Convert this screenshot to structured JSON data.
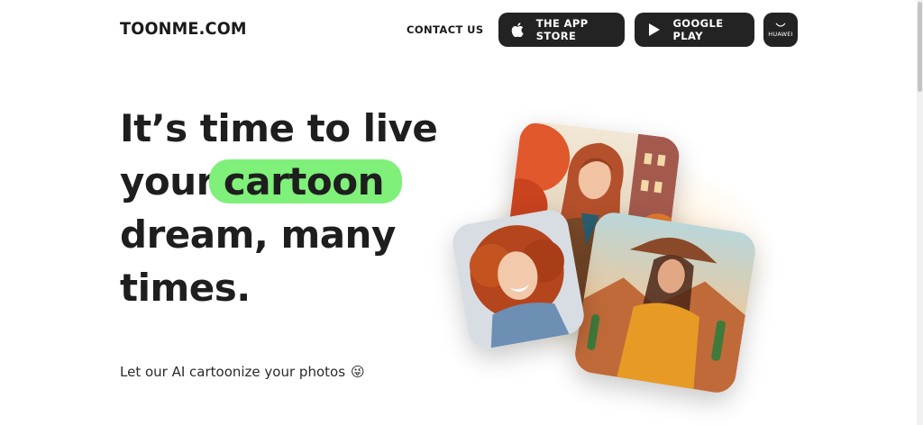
{
  "header": {
    "logo": "TOONME.COM",
    "contact": "CONTACT US",
    "app_store": "THE APP STORE",
    "google_play": "GOOGLE PLAY",
    "huawei": "HUAWEI"
  },
  "hero": {
    "line1": "It’s time to live",
    "line2_pre": "your",
    "line2_highlight": "cartoon",
    "line3": "dream, many",
    "line4": "times.",
    "subtitle": "Let our AI cartoonize your photos",
    "emoji": "😜"
  },
  "colors": {
    "highlight": "#7ff07a",
    "button_bg": "#232323"
  },
  "icons": [
    "apple-icon",
    "play-icon",
    "huawei-icon"
  ]
}
